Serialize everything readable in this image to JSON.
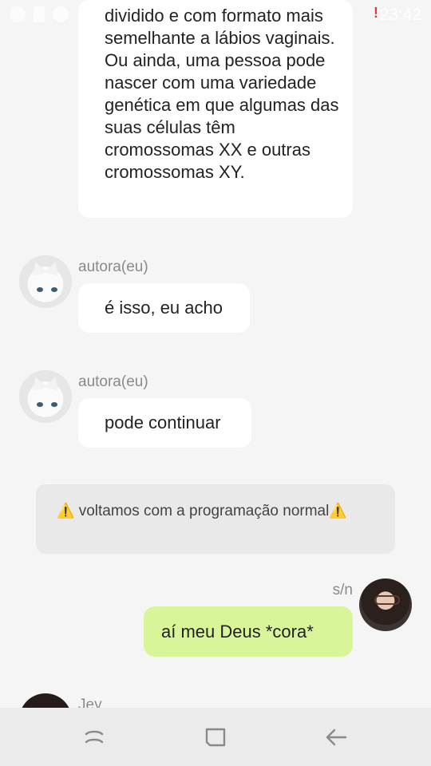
{
  "status_bar": {
    "time": "23:42",
    "alert": "!"
  },
  "messages": [
    {
      "text": "dividido e com formato mais semelhante a lábios vaginais. Ou ainda, uma pessoa pode nascer com uma variedade genética em que algumas das suas células têm cromossomas XX e outras cromossomas XY."
    },
    {
      "author": "autora(eu)",
      "text": "é isso, eu acho"
    },
    {
      "author": "autora(eu)",
      "text": "pode continuar"
    },
    {
      "author": "s/n",
      "text": "aí meu Deus *cora*"
    },
    {
      "author": "Jey"
    }
  ],
  "system_message": {
    "text": "voltamos com a programação normal",
    "icon": "warning-icon"
  },
  "nav": {
    "recent": "recent-apps-icon",
    "home": "home-icon",
    "back": "back-icon"
  },
  "colors": {
    "my_bubble": "#d9f59a",
    "other_bubble": "#ffffff",
    "system_bubble": "#e9e9e9"
  }
}
